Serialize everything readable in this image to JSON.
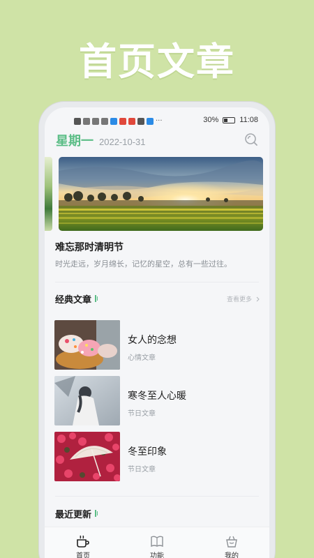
{
  "promo": {
    "title": "首页文章"
  },
  "status_bar": {
    "battery": "30%",
    "time": "11:08"
  },
  "header": {
    "weekday": "星期一",
    "date": "2022-10-31"
  },
  "feature": {
    "title": "难忘那时清明节",
    "description": "时光走远，岁月绵长，记忆的星空，总有一些过往。"
  },
  "classic_section": {
    "title": "经典文章",
    "more_label": "查看更多"
  },
  "articles": [
    {
      "title": "女人的念想",
      "category": "心情文章"
    },
    {
      "title": "寒冬至人心暖",
      "category": "节日文章"
    },
    {
      "title": "冬至印象",
      "category": "节日文章"
    }
  ],
  "recent_section": {
    "title": "最近更新"
  },
  "tabs": [
    {
      "label": "首页"
    },
    {
      "label": "功能"
    },
    {
      "label": "我的"
    }
  ],
  "colors": {
    "accent": "#5bbd86",
    "background": "#cfe3a6"
  }
}
